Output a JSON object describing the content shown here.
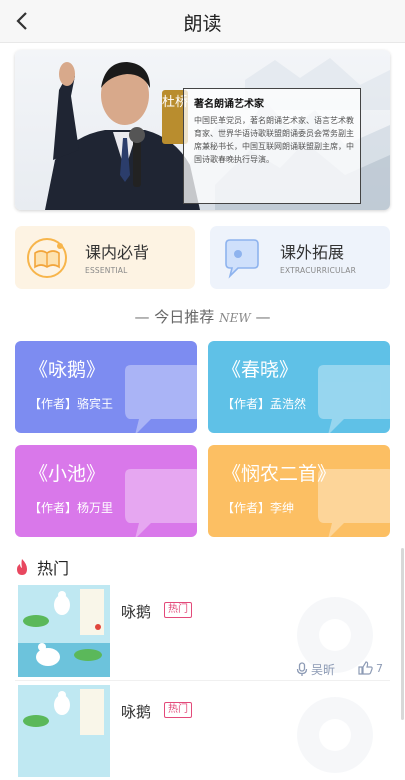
{
  "header": {
    "title": "朗读"
  },
  "banner": {
    "seal_name": "杜桥",
    "card_title": "著名朗诵艺术家",
    "card_desc": "中国民革党员，著名朗诵艺术家、语言艺术教育家、世界华语诗歌联盟朗诵委员会常务副主席兼秘书长，中国互联网朗诵联盟副主席，中国诗歌春晚执行导演。"
  },
  "categories": [
    {
      "title": "课内必背",
      "subtitle": "ESSENTIAL",
      "icon": "book-icon"
    },
    {
      "title": "课外拓展",
      "subtitle": "EXTRACURRICULAR",
      "icon": "chat-bubble-icon"
    }
  ],
  "recommend": {
    "title": "今日推荐",
    "badge": "NEW"
  },
  "poems": [
    {
      "title": "《咏鹅》",
      "author": "【作者】骆宾王",
      "color": "#7d8cf1"
    },
    {
      "title": "《春晓》",
      "author": "【作者】孟浩然",
      "color": "#5fc1e7"
    },
    {
      "title": "《小池》",
      "author": "【作者】杨万里",
      "color": "#d978ea"
    },
    {
      "title": "《悯农二首》",
      "author": "【作者】李绅",
      "color": "#fcbf63"
    }
  ],
  "hot": {
    "title": "热门",
    "items": [
      {
        "title": "咏鹅",
        "tag": "热门",
        "listen_label": "吴昕",
        "likes": "7"
      },
      {
        "title": "咏鹅",
        "tag": "热门"
      }
    ]
  },
  "colors": {
    "accent_pink": "#e34a7a",
    "meta_blue": "#8d9bb5",
    "hot_flame": "#e8475f"
  }
}
